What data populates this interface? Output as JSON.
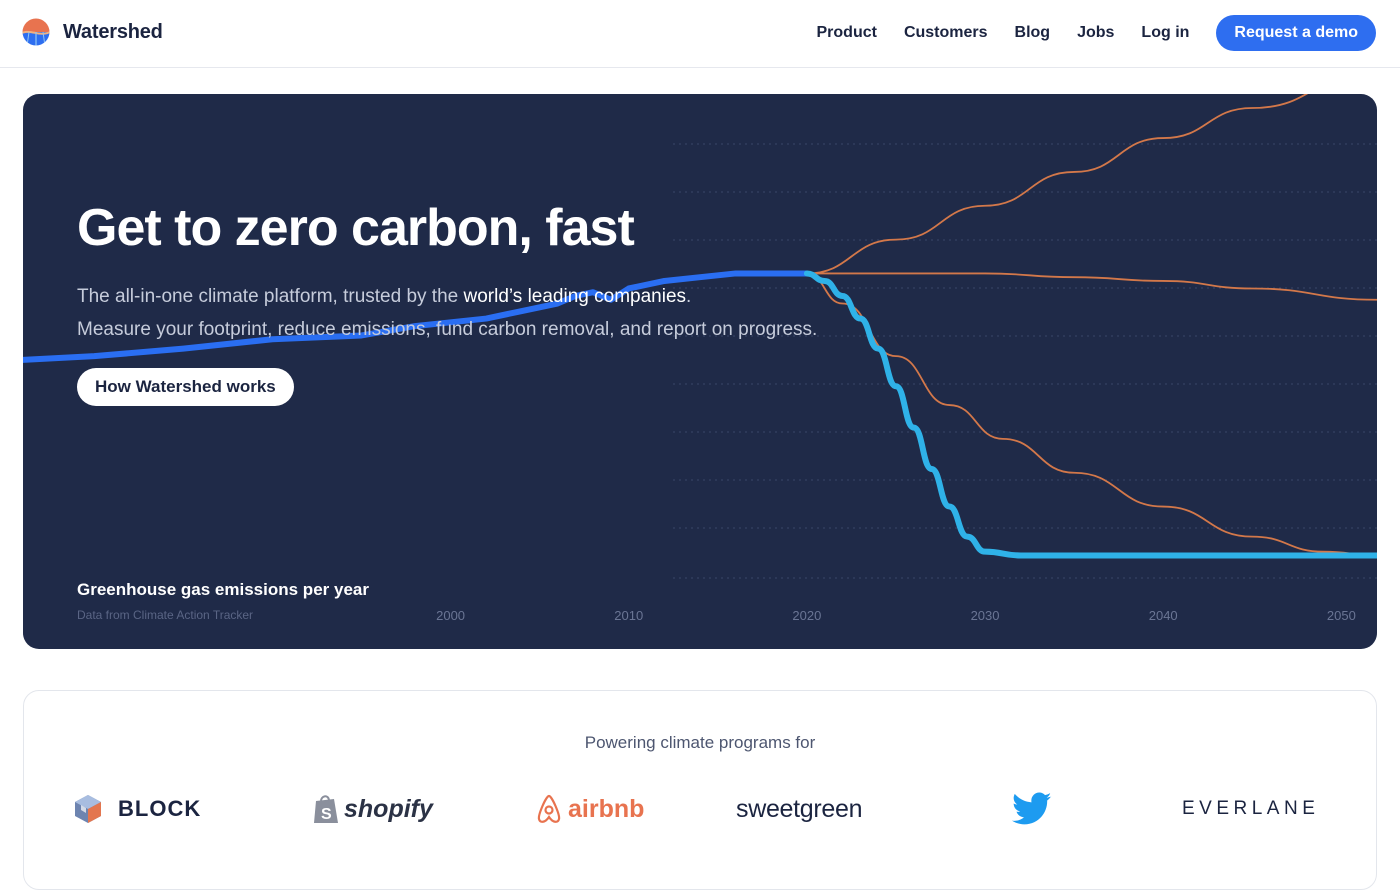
{
  "header": {
    "brand_name": "Watershed",
    "nav": {
      "product": "Product",
      "customers": "Customers",
      "blog": "Blog",
      "jobs": "Jobs",
      "login": "Log in",
      "cta": "Request a demo"
    }
  },
  "hero": {
    "title": "Get to zero carbon, fast",
    "subtitle_line1_prefix": "The all-in-one climate platform, trusted by the ",
    "subtitle_line1_highlight": "world’s leading companies",
    "subtitle_line1_suffix": ".",
    "subtitle_line2": "Measure your footprint, reduce emissions, fund carbon removal, and report on progress.",
    "button_label": "How Watershed works"
  },
  "chart_data": {
    "type": "line",
    "title": "Greenhouse gas emissions per year",
    "subtitle": "Data from Climate Action Tracker",
    "xlabel": "",
    "ylabel": "",
    "x_ticks": [
      2000,
      2010,
      2020,
      2030,
      2040,
      2050
    ],
    "xlim": [
      1976,
      2052
    ],
    "ylim": [
      0,
      100
    ],
    "grid": true,
    "series": [
      {
        "key": "historical",
        "color": "#2a6ef2",
        "x": [
          1976,
          1980,
          1985,
          1990,
          1995,
          1998,
          2000,
          2002,
          2004,
          2006,
          2007,
          2008,
          2009,
          2010,
          2012,
          2014,
          2016,
          2018,
          2019,
          2020
        ],
        "y": [
          58,
          59,
          61,
          63.5,
          64.5,
          67,
          68,
          69,
          71,
          73,
          75,
          76,
          74,
          77,
          79,
          80,
          81,
          81,
          81,
          81
        ]
      },
      {
        "key": "pathway-zero",
        "color": "#2fb2e8",
        "x": [
          2020,
          2021,
          2022,
          2023,
          2024,
          2025,
          2026,
          2027,
          2028,
          2029,
          2030,
          2032,
          2036,
          2040,
          2044,
          2048,
          2052
        ],
        "y": [
          81,
          79,
          75,
          69,
          61,
          51,
          40,
          29,
          19,
          11,
          7,
          6,
          6,
          6,
          6,
          6,
          6
        ]
      },
      {
        "key": "scenario-rising",
        "color": "#d3784a",
        "x": [
          2020,
          2025,
          2030,
          2035,
          2040,
          2045,
          2052
        ],
        "y": [
          81,
          90,
          99,
          108,
          117,
          125,
          135
        ]
      },
      {
        "key": "scenario-flat",
        "color": "#d3784a",
        "x": [
          2020,
          2025,
          2030,
          2035,
          2040,
          2045,
          2052
        ],
        "y": [
          81,
          81,
          81,
          80,
          79,
          77,
          74
        ]
      },
      {
        "key": "scenario-declining",
        "color": "#d3784a",
        "x": [
          2020,
          2022,
          2025,
          2028,
          2031,
          2035,
          2040,
          2045,
          2049,
          2052
        ],
        "y": [
          81,
          73,
          59,
          46,
          37,
          28,
          19,
          11,
          7,
          6
        ]
      }
    ]
  },
  "customers": {
    "heading": "Powering climate programs for",
    "logos": [
      {
        "name": "BLOCK",
        "icon": "block-cube-icon"
      },
      {
        "name": "shopify",
        "icon": "shopify-bag-icon"
      },
      {
        "name": "airbnb",
        "icon": "airbnb-belo-icon"
      },
      {
        "name": "sweetgreen",
        "icon": ""
      },
      {
        "name": "Twitter",
        "icon": "twitter-bird-icon"
      },
      {
        "name": "EVERLANE",
        "icon": ""
      }
    ],
    "colors": {
      "block": "#1b2440",
      "shopify": "#2b3245",
      "airbnb": "#e8734f",
      "sweetgreen": "#1b2440",
      "twitter": "#1d9bf0",
      "everlane": "#1b2440"
    }
  }
}
